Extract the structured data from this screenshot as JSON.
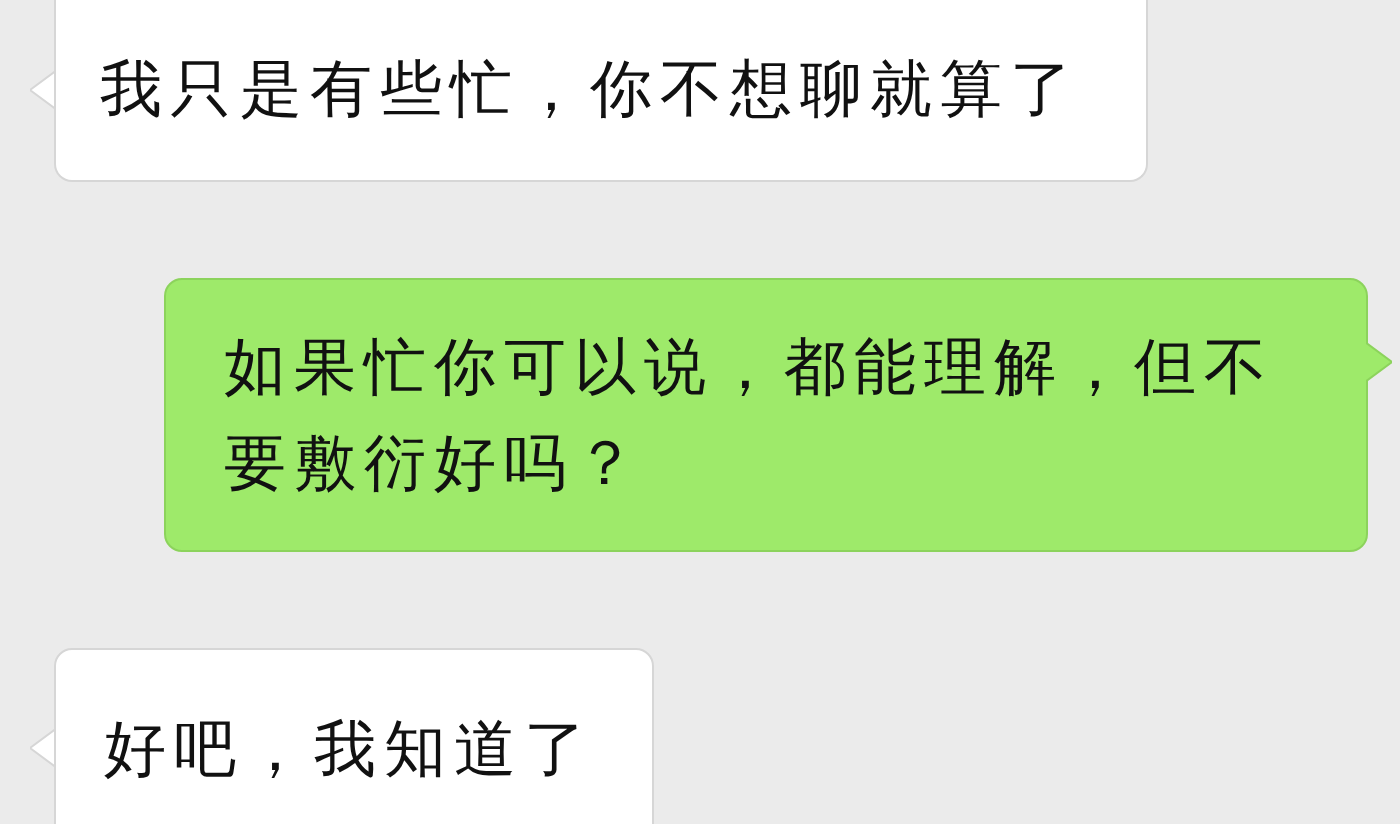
{
  "messages": [
    {
      "kind": "received",
      "text": "我只是有些忙，你不想聊就算了"
    },
    {
      "kind": "sent",
      "text": "如果忙你可以说，都能理解，但不要敷衍好吗？"
    },
    {
      "kind": "received",
      "text": "好吧，我知道了"
    }
  ]
}
